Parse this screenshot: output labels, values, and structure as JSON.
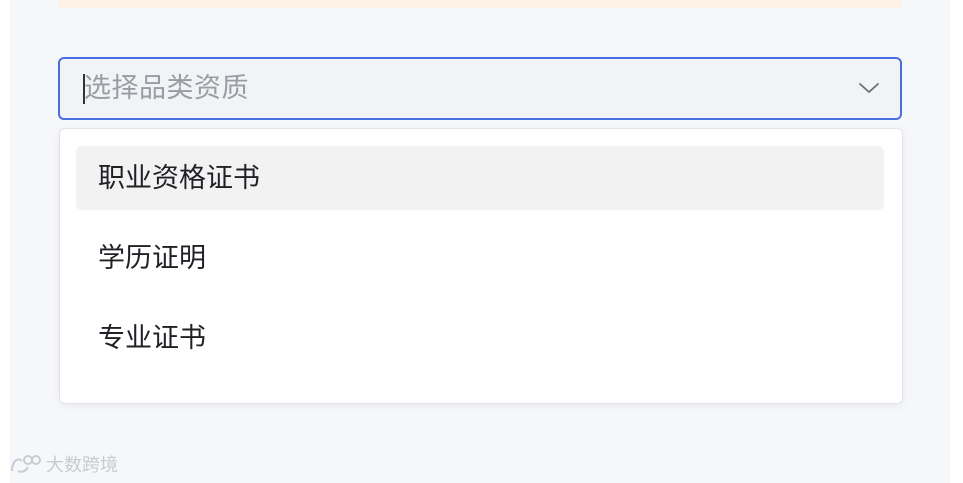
{
  "select": {
    "placeholder": "选择品类资质",
    "icon": "chevron-down-icon"
  },
  "dropdown": {
    "options": [
      {
        "label": "职业资格证书",
        "hovered": true
      },
      {
        "label": "学历证明",
        "hovered": false
      },
      {
        "label": "专业证书",
        "hovered": false
      }
    ]
  },
  "watermark": {
    "text": "大数跨境"
  },
  "colors": {
    "accent": "#4a6ee0",
    "background": "#f6f7fa",
    "hover": "#f2f2f3",
    "notice": "#fcf2e6"
  }
}
